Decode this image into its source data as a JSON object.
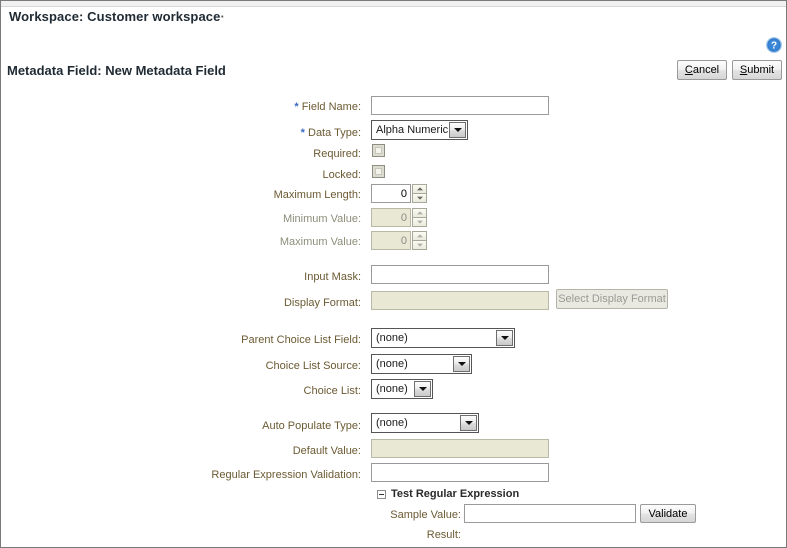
{
  "workspace": {
    "title": "Workspace: Customer workspace",
    "tick": "·"
  },
  "page": {
    "title": "Metadata Field: New Metadata Field"
  },
  "toolbar": {
    "cancel_label_pre": "",
    "cancel_accel": "C",
    "cancel_label_post": "ancel",
    "submit_accel": "S",
    "submit_label_post": "ubmit",
    "help_icon": "help-question-icon"
  },
  "form": {
    "fields": [
      {
        "label": "Field Name:",
        "required": true,
        "type": "text",
        "value": "",
        "disabled": false
      },
      {
        "label": "Data Type:",
        "required": true,
        "type": "select",
        "value": "Alpha Numeric",
        "disabled": false
      },
      {
        "label": "Required:",
        "required": false,
        "type": "checkbox",
        "value": "",
        "checked": false,
        "disabled": false
      },
      {
        "label": "Locked:",
        "required": false,
        "type": "checkbox",
        "value": "",
        "checked": false,
        "disabled": false
      },
      {
        "label": "Maximum Length:",
        "required": false,
        "type": "spinner",
        "value": "0",
        "disabled": false
      },
      {
        "label": "Minimum Value:",
        "required": false,
        "type": "spinner",
        "value": "0",
        "disabled": true
      },
      {
        "label": "Maximum Value:",
        "required": false,
        "type": "spinner",
        "value": "0",
        "disabled": true
      },
      {
        "label": "Input Mask:",
        "required": false,
        "type": "text",
        "value": "",
        "disabled": false
      },
      {
        "label": "Display Format:",
        "required": false,
        "type": "text",
        "value": "",
        "disabled": true
      },
      {
        "label": "Parent Choice List Field:",
        "required": false,
        "type": "select",
        "value": "(none)",
        "disabled": false
      },
      {
        "label": "Choice List Source:",
        "required": false,
        "type": "select",
        "value": "(none)",
        "disabled": false
      },
      {
        "label": "Choice List:",
        "required": false,
        "type": "select",
        "value": "(none)",
        "disabled": false
      },
      {
        "label": "Auto Populate Type:",
        "required": false,
        "type": "select",
        "value": "(none)",
        "disabled": false
      },
      {
        "label": "Default Value:",
        "required": false,
        "type": "text",
        "value": "",
        "disabled": true
      },
      {
        "label": "Regular Expression Validation:",
        "required": false,
        "type": "text",
        "value": "",
        "disabled": false
      }
    ],
    "select_display_format_button": "Select Display Format"
  },
  "test_regex": {
    "heading": "Test Regular Expression",
    "toggle_state": "expanded",
    "sample_value_label": "Sample Value:",
    "sample_value": "",
    "validate_button": "Validate",
    "result_label": "Result:",
    "result_value": ""
  },
  "colors": {
    "label": "#6b5a33",
    "required_asterisk": "#3b6bbf",
    "heading": "#1f2a33",
    "disabled_field_bg": "#e8e8d5",
    "help_icon": "#2f79c8"
  }
}
